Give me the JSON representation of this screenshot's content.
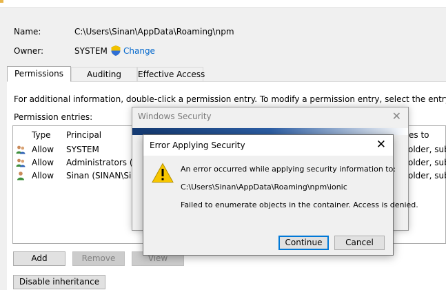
{
  "header": {
    "name_label": "Name:",
    "name_value": "C:\\Users\\Sinan\\AppData\\Roaming\\npm",
    "owner_label": "Owner:",
    "owner_value": "SYSTEM",
    "change_link": "Change"
  },
  "tabs": [
    {
      "label": "Permissions",
      "active": true
    },
    {
      "label": "Auditing",
      "active": false
    },
    {
      "label": "Effective Access",
      "active": false
    }
  ],
  "info_text": "For additional information, double-click a permission entry. To modify a permission entry, select the entry and click Edit",
  "entries_label": "Permission entries:",
  "columns": {
    "type": "Type",
    "principal": "Principal",
    "applies_to": "es to"
  },
  "rows": [
    {
      "type": "Allow",
      "principal": "SYSTEM",
      "applies": "older, subfo"
    },
    {
      "type": "Allow",
      "principal": "Administrators (SI",
      "applies": "older, subfo"
    },
    {
      "type": "Allow",
      "principal": "Sinan (SINAN\\Sina",
      "applies": "older, subfo"
    }
  ],
  "buttons": {
    "add": "Add",
    "remove": "Remove",
    "view": "View",
    "disable_inheritance": "Disable inheritance"
  },
  "windows_security": {
    "title": "Windows Security",
    "close": "✕"
  },
  "error_dialog": {
    "title": "Error Applying Security",
    "close": "✕",
    "line1": "An error occurred while applying security information to:",
    "path": "C:\\Users\\Sinan\\AppData\\Roaming\\npm\\ionic",
    "line2": "Failed to enumerate objects in the container. Access is denied.",
    "continue": "Continue",
    "cancel": "Cancel"
  },
  "colors": {
    "link": "#0066cc",
    "focus": "#0078d7",
    "warning": "#f7c600"
  }
}
